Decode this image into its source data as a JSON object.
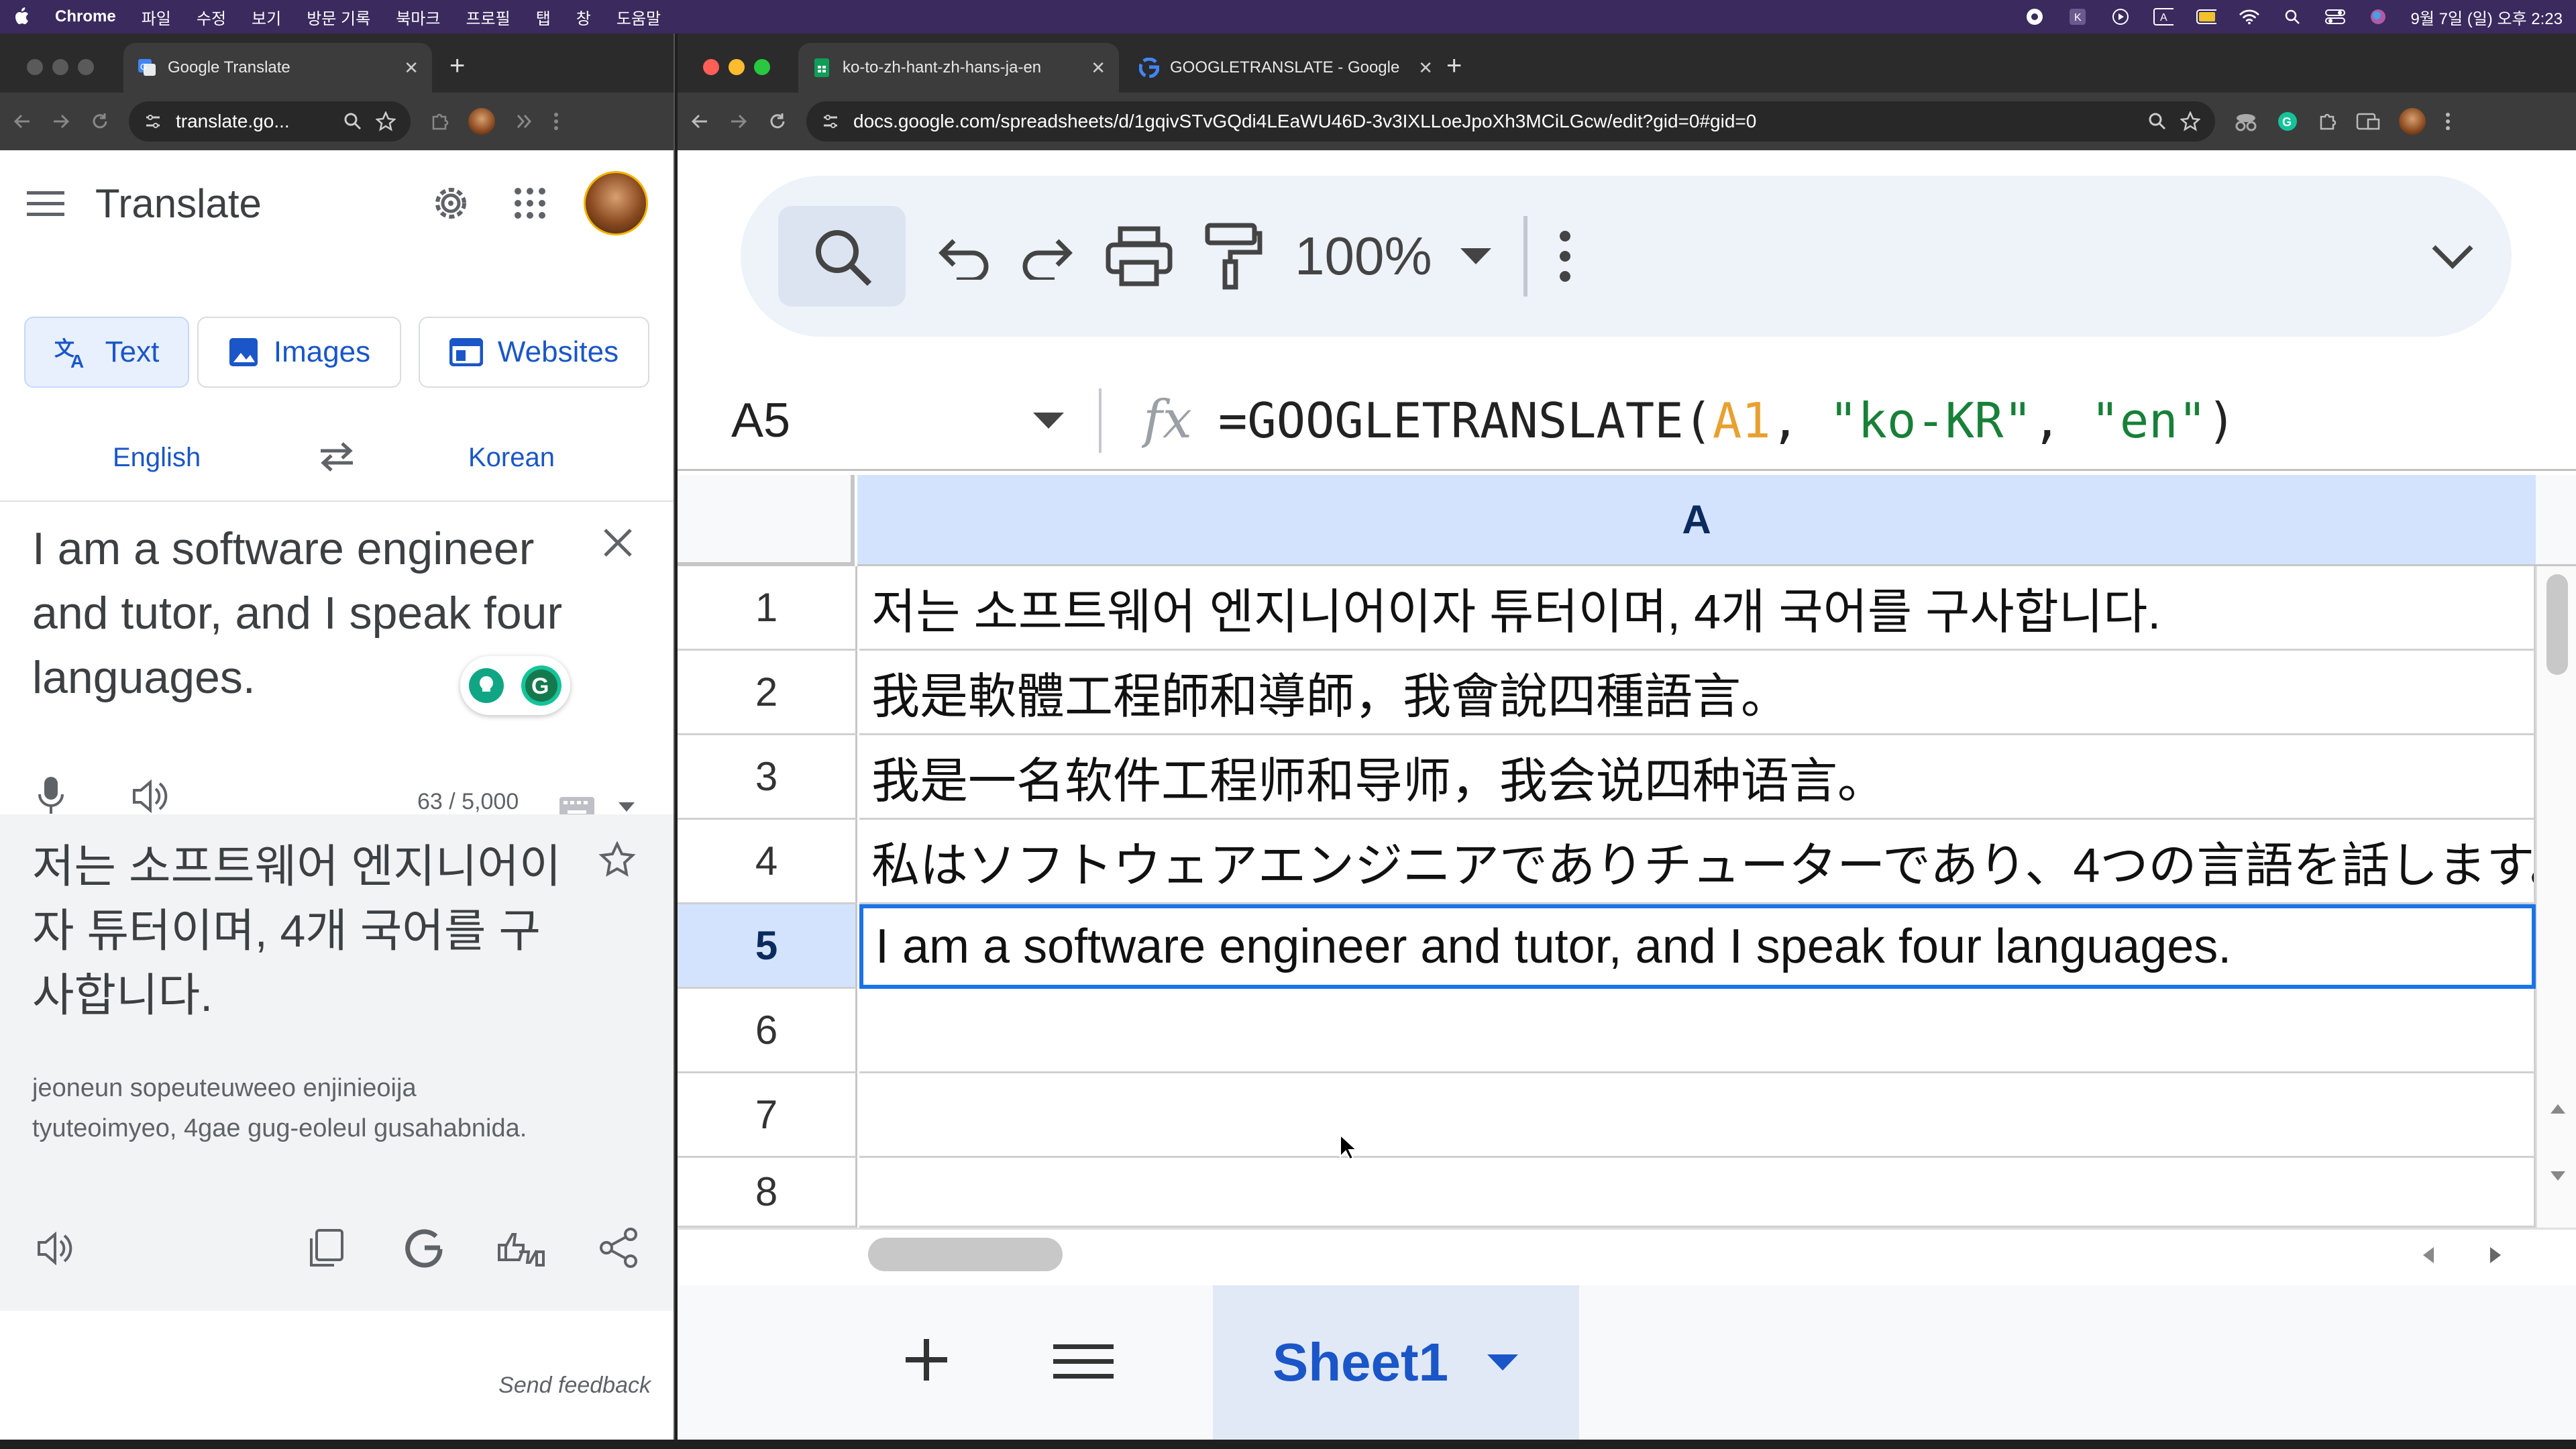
{
  "menubar": {
    "app": "Chrome",
    "items": [
      "파일",
      "수정",
      "보기",
      "방문 기록",
      "북마크",
      "프로필",
      "탭",
      "창",
      "도움말"
    ],
    "datetime": "9월 7일 (일) 오후 2:23"
  },
  "left_window": {
    "tab_title": "Google Translate",
    "url": "translate.go...",
    "page": {
      "title": "Translate",
      "modes": [
        "Text",
        "Images",
        "Websites"
      ],
      "source_lang": "English",
      "target_lang": "Korean",
      "source_text": "I am a software engineer and tutor, and I speak four languages.",
      "char_count": "63 / 5,000",
      "translation": "저는 소프트웨어 엔지니어이자 튜터이며, 4개 국어를 구사합니다.",
      "romanization": "jeoneun sopeuteuweeo enjinieoija tyuteoimyeo, 4gae gug-eoleul gusahabnida.",
      "feedback": "Send feedback"
    }
  },
  "right_window": {
    "tabs": [
      "ko-to-zh-hant-zh-hans-ja-en",
      "GOOGLETRANSLATE - Google"
    ],
    "url": "docs.google.com/spreadsheets/d/1gqivSTvGQdi4LEaWU46D-3v3IXLLoeJpoXh3MCiLGcw/edit?gid=0#gid=0",
    "sheet": {
      "zoom": "100%",
      "cell_ref": "A5",
      "formula_prefix": "=GOOGLETRANSLATE(",
      "formula_ref": "A1",
      "formula_sep1": ", ",
      "formula_str1": "\"ko-KR\"",
      "formula_sep2": ", ",
      "formula_str2": "\"en\"",
      "formula_suffix": ")",
      "column": "A",
      "rows": [
        {
          "num": "1",
          "value": "저는 소프트웨어 엔지니어이자 튜터이며, 4개 국어를 구사합니다."
        },
        {
          "num": "2",
          "value": "我是軟體工程師和導師，我會說四種語言。"
        },
        {
          "num": "3",
          "value": "我是一名软件工程师和导师，我会说四种语言。"
        },
        {
          "num": "4",
          "value": "私はソフトウェアエンジニアでありチューターであり、4つの言語を話します。"
        },
        {
          "num": "5",
          "value": "I am a software engineer and tutor, and I speak four languages."
        },
        {
          "num": "6",
          "value": ""
        },
        {
          "num": "7",
          "value": ""
        },
        {
          "num": "8",
          "value": ""
        }
      ],
      "selected_row": 5,
      "sheet_tab": "Sheet1"
    }
  },
  "colors": {
    "accent": "#1a73e8",
    "menubar": "#3a2a5e",
    "header_selected": "#d3e3fd",
    "formula_ref": "#e8a030",
    "formula_string": "#188038"
  }
}
